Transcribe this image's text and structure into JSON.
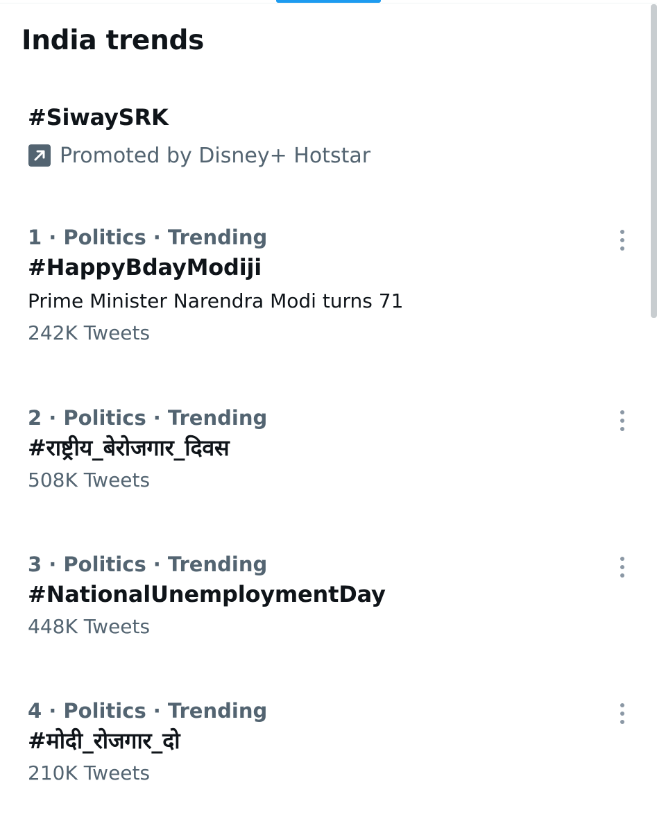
{
  "page": {
    "title": "India trends"
  },
  "colors": {
    "accent": "#1d9bf0",
    "primary_text": "#0f1419",
    "secondary_text": "#536471",
    "promo_icon_bg": "#536471"
  },
  "promoted": {
    "name": "#SiwaySRK",
    "label": "Promoted by Disney+ Hotstar",
    "icon": "promoted-arrow-icon"
  },
  "trends": [
    {
      "meta": "1 · Politics · Trending",
      "name": "#HappyBdayModiji",
      "description": "Prime Minister Narendra Modi turns 71",
      "count": "242K Tweets",
      "more_icon": "more-vertical-icon"
    },
    {
      "meta": "2 · Politics · Trending",
      "name": "#राष्ट्रीय_बेरोजगार_दिवस",
      "count": "508K Tweets",
      "more_icon": "more-vertical-icon"
    },
    {
      "meta": "3 · Politics · Trending",
      "name": "#NationalUnemploymentDay",
      "count": "448K Tweets",
      "more_icon": "more-vertical-icon"
    },
    {
      "meta": "4 · Politics · Trending",
      "name": "#मोदी_रोजगार_दो",
      "count": "210K Tweets",
      "more_icon": "more-vertical-icon"
    }
  ]
}
